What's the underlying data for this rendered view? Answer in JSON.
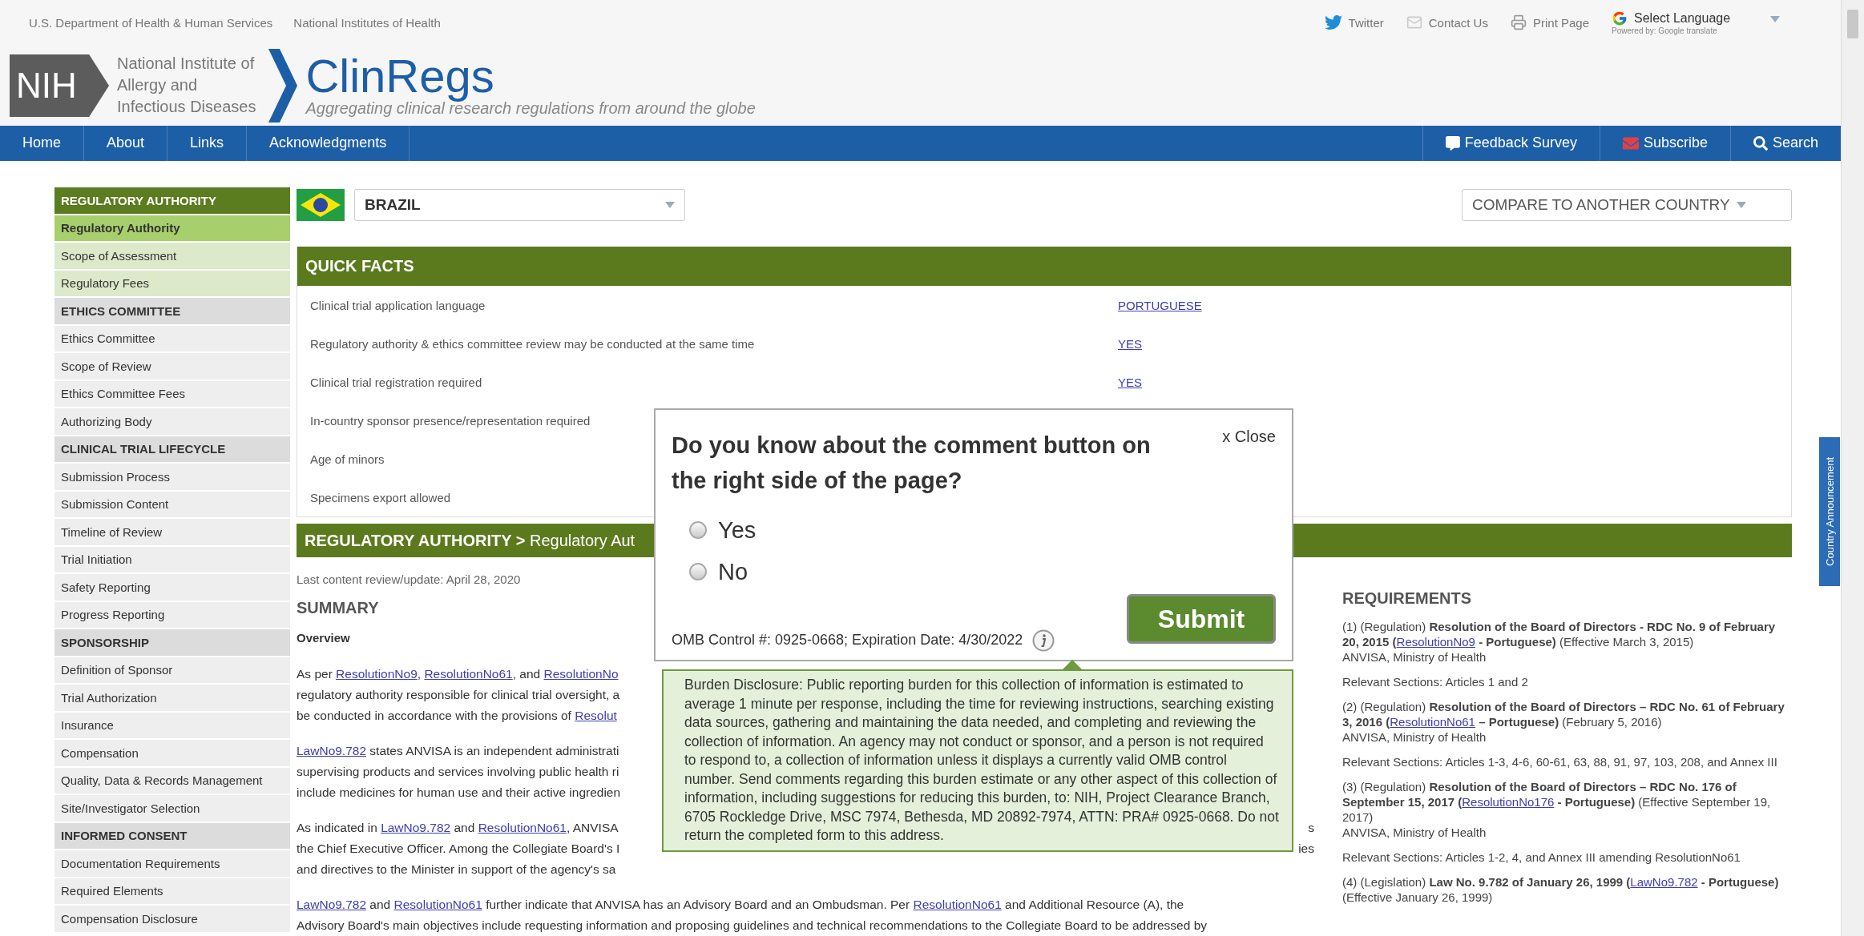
{
  "top_bar": {
    "agency_links": [
      "U.S. Department of Health & Human Services",
      "National Institutes of Health"
    ],
    "tools": [
      {
        "label": "Twitter",
        "kind": "twitter"
      },
      {
        "label": "Contact Us",
        "kind": "mail"
      },
      {
        "label": "Print Page",
        "kind": "print"
      }
    ],
    "translate": {
      "label": "Select Language",
      "powered_by": "Powered by: Google translate"
    }
  },
  "logo": {
    "mark": "NIH",
    "institute_lines": [
      "National Institute of",
      "Allergy and",
      "Infectious Diseases"
    ],
    "site_name": "ClinRegs",
    "tagline": "Aggregating clinical research regulations from around the globe"
  },
  "nav": {
    "left": [
      "Home",
      "About",
      "Links",
      "Acknowledgments"
    ],
    "right": [
      {
        "label": "Feedback Survey",
        "kind": "feedback"
      },
      {
        "label": "Subscribe",
        "kind": "subscribe"
      },
      {
        "label": "Search",
        "kind": "search"
      }
    ]
  },
  "sidebar": {
    "sections": [
      {
        "title": "REGULATORY AUTHORITY",
        "active": true,
        "items": [
          {
            "label": "Regulatory Authority",
            "selected": true
          },
          {
            "label": "Scope of Assessment",
            "selected": false
          },
          {
            "label": "Regulatory Fees",
            "selected": false
          }
        ]
      },
      {
        "title": "ETHICS COMMITTEE",
        "active": false,
        "items": [
          {
            "label": "Ethics Committee",
            "selected": false
          },
          {
            "label": "Scope of Review",
            "selected": false
          },
          {
            "label": "Ethics Committee Fees",
            "selected": false
          },
          {
            "label": "Authorizing Body",
            "selected": false
          }
        ]
      },
      {
        "title": "CLINICAL TRIAL LIFECYCLE",
        "active": false,
        "items": [
          {
            "label": "Submission Process",
            "selected": false
          },
          {
            "label": "Submission Content",
            "selected": false
          },
          {
            "label": "Timeline of Review",
            "selected": false
          },
          {
            "label": "Trial Initiation",
            "selected": false
          },
          {
            "label": "Safety Reporting",
            "selected": false
          },
          {
            "label": "Progress Reporting",
            "selected": false
          }
        ]
      },
      {
        "title": "SPONSORSHIP",
        "active": false,
        "items": [
          {
            "label": "Definition of Sponsor",
            "selected": false
          },
          {
            "label": "Trial Authorization",
            "selected": false
          },
          {
            "label": "Insurance",
            "selected": false
          },
          {
            "label": "Compensation",
            "selected": false
          },
          {
            "label": "Quality, Data & Records Management",
            "selected": false
          },
          {
            "label": "Site/Investigator Selection",
            "selected": false
          }
        ]
      },
      {
        "title": "INFORMED CONSENT",
        "active": false,
        "items": [
          {
            "label": "Documentation Requirements",
            "selected": false
          },
          {
            "label": "Required Elements",
            "selected": false
          },
          {
            "label": "Compensation Disclosure",
            "selected": false
          }
        ]
      }
    ]
  },
  "country_select": {
    "value": "BRAZIL"
  },
  "compare_select": {
    "placeholder": "COMPARE TO ANOTHER COUNTRY"
  },
  "quick_facts": {
    "title": "QUICK FACTS",
    "rows": [
      {
        "label": "Clinical trial application language",
        "value": "PORTUGUESE"
      },
      {
        "label": "Regulatory authority & ethics committee review may be conducted at the same time",
        "value": "YES"
      },
      {
        "label": "Clinical trial registration required",
        "value": "YES"
      },
      {
        "label": "In-country sponsor presence/representation required"
      },
      {
        "label": "Age of minors"
      },
      {
        "label": "Specimens export allowed"
      }
    ]
  },
  "section_header": "**REGULATORY AUTHORITY >** Regulatory Aut",
  "review_date": "Last content review/update: April 28, 2020",
  "summary": {
    "title": "SUMMARY",
    "subtitle": "Overview",
    "paragraphs": [
      {
        "lines": [
          {
            "left": [
              {
                "kind": "text",
                "t": "As per "
              },
              {
                "kind": "link",
                "t": "ResolutionNo9"
              },
              {
                "kind": "text",
                "t": ", "
              },
              {
                "kind": "link",
                "t": "ResolutionNo61"
              },
              {
                "kind": "text",
                "t": ", and "
              },
              {
                "kind": "link",
                "t": "ResolutionNo"
              }
            ]
          },
          {
            "left": [
              {
                "kind": "text",
                "t": "regulatory authority responsible for clinical trial oversight, a"
              }
            ]
          },
          {
            "left": [
              {
                "kind": "text",
                "t": "be conducted in accordance with the provisions of "
              },
              {
                "kind": "link",
                "t": "Resolut"
              }
            ]
          }
        ]
      },
      {
        "lines": [
          {
            "left": [
              {
                "kind": "link",
                "t": "LawNo9.782"
              },
              {
                "kind": "text",
                "t": " states ANVISA is an independent administrati"
              }
            ]
          },
          {
            "left": [
              {
                "kind": "text",
                "t": "supervising products and services involving public health ri"
              }
            ]
          },
          {
            "left": [
              {
                "kind": "text",
                "t": "include medicines for human use and their active ingredien"
              }
            ]
          }
        ]
      },
      {
        "lines": [
          {
            "left": [
              {
                "kind": "text",
                "t": "As indicated in "
              },
              {
                "kind": "link",
                "t": "LawNo9.782"
              },
              {
                "kind": "text",
                "t": " and "
              },
              {
                "kind": "link",
                "t": "ResolutionNo61"
              },
              {
                "kind": "text",
                "t": ", ANVISA"
              }
            ],
            "right": "s"
          },
          {
            "left": [
              {
                "kind": "text",
                "t": "the Chief Executive Officer. Among the Collegiate Board's I"
              }
            ],
            "right": "ies"
          },
          {
            "left": [
              {
                "kind": "text",
                "t": "and directives to the Minister in support of the agency's sa"
              }
            ]
          }
        ]
      },
      {
        "lines": [
          {
            "left": [
              {
                "kind": "link",
                "t": "LawNo9.782"
              },
              {
                "kind": "text",
                "t": " and "
              },
              {
                "kind": "link",
                "t": "ResolutionNo61"
              },
              {
                "kind": "text",
                "t": " further indicate that ANVISA has an Advisory Board and an Ombudsman. Per "
              },
              {
                "kind": "link",
                "t": "ResolutionNo61"
              },
              {
                "kind": "text",
                "t": " and Additional Resource (A), the"
              }
            ]
          },
          {
            "left": [
              {
                "kind": "text",
                "t": "Advisory Board's main objectives include requesting information and proposing guidelines and technical recommendations to the Collegiate Board to be addressed by"
              }
            ]
          }
        ]
      }
    ]
  },
  "requirements": {
    "title": "REQUIREMENTS",
    "items": [
      {
        "citation": [
          {
            "kind": "text",
            "t": "(1) (Regulation) "
          },
          {
            "kind": "bold",
            "t": "Resolution of the Board of Directors - RDC No. 9 of February 20, 2015 ("
          },
          {
            "kind": "link",
            "t": "ResolutionNo9"
          },
          {
            "kind": "bold",
            "t": " - Portuguese)"
          },
          {
            "kind": "text",
            "t": " (Effective March 3, 2015)"
          }
        ],
        "issuer": "ANVISA, Ministry of Health",
        "sections": "Relevant Sections: Articles 1 and 2"
      },
      {
        "citation": [
          {
            "kind": "text",
            "t": "(2) (Regulation) "
          },
          {
            "kind": "bold",
            "t": "Resolution of the Board of Directors – RDC No. 61 of February 3, 2016 ("
          },
          {
            "kind": "link",
            "t": "ResolutionNo61"
          },
          {
            "kind": "bold",
            "t": " – Portuguese)"
          },
          {
            "kind": "text",
            "t": " (February 5, 2016)"
          }
        ],
        "issuer": "ANVISA, Ministry of Health",
        "sections": "Relevant Sections: Articles 1-3, 4-6, 60-61, 63, 88, 91, 97, 103, 208, and Annex III"
      },
      {
        "citation": [
          {
            "kind": "text",
            "t": "(3) (Regulation) "
          },
          {
            "kind": "bold",
            "t": "Resolution of the Board of Directors – RDC No. 176 of September 15, 2017 ("
          },
          {
            "kind": "link",
            "t": "ResolutionNo176"
          },
          {
            "kind": "bold",
            "t": " - Portuguese)"
          },
          {
            "kind": "text",
            "t": " (Effective September 19, 2017)"
          }
        ],
        "issuer": "ANVISA, Ministry of Health",
        "sections": "Relevant Sections: Articles 1-2, 4, and Annex III amending ResolutionNo61"
      },
      {
        "citation": [
          {
            "kind": "text",
            "t": "(4) (Legislation) "
          },
          {
            "kind": "bold",
            "t": "Law No. 9.782 of January 26, 1999 ("
          },
          {
            "kind": "link",
            "t": "LawNo9.782"
          },
          {
            "kind": "bold",
            "t": " - Portuguese)"
          },
          {
            "kind": "text",
            "t": " (Effective January 26, 1999)"
          }
        ]
      }
    ]
  },
  "side_tab": "Country Announcement",
  "modal": {
    "question": "Do you know about the comment button on the right side of the page?",
    "close": "x Close",
    "options": [
      {
        "label": "Yes",
        "selected": false
      },
      {
        "label": "No",
        "selected": false
      }
    ],
    "submit": "Submit",
    "omb": "OMB Control #: 0925-0668; Expiration Date: 4/30/2022",
    "disclosure": "Burden Disclosure: Public reporting burden for this collection of information is estimated to average 1 minute per response, including the time for reviewing instructions, searching existing data sources, gathering and maintaining the data needed, and completing and reviewing the collection of information. An agency may not conduct or sponsor, and a person is not required to respond to, a collection of information unless it displays a currently valid OMB control number. Send comments regarding this burden estimate or any other aspect of this collection of information, including suggestions for reducing this burden, to: NIH, Project Clearance Branch, 6705 Rockledge Drive, MSC 7974, Bethesda, MD 20892-7974, ATTN: PRA# 0925-0668. Do not return the completed form to this address."
  }
}
